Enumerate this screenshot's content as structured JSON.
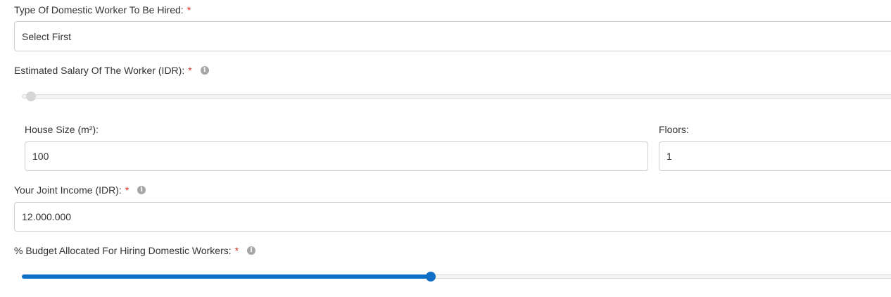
{
  "worker_type": {
    "label": "Type Of Domestic Worker To Be Hired:",
    "required_mark": "*",
    "selected": "Select First"
  },
  "salary": {
    "label": "Estimated Salary Of The Worker (IDR):",
    "required_mark": "*",
    "info_icon": "info-icon",
    "slider_fraction": 0.0
  },
  "house_size": {
    "label": "House Size (m²):",
    "value": "100"
  },
  "floors": {
    "label": "Floors:",
    "value": "1"
  },
  "joint_income": {
    "label": "Your Joint Income (IDR):",
    "required_mark": "*",
    "info_icon": "info-icon",
    "value": "12.000.000"
  },
  "budget": {
    "label": "% Budget Allocated For Hiring Domestic Workers:",
    "required_mark": "*",
    "info_icon": "info-icon",
    "slider_fraction": 0.46
  },
  "colors": {
    "accent": "#0d6fc6",
    "required": "#d9301f",
    "border": "#cfcfcf",
    "disabled_thumb": "#d6d6d6"
  }
}
